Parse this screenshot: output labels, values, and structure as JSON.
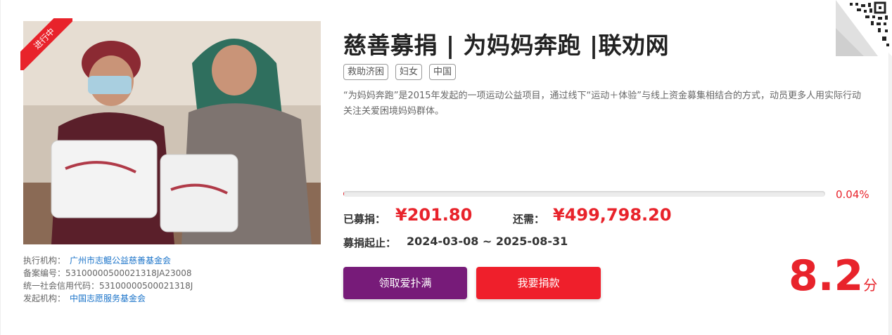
{
  "status_ribbon": "进行中",
  "title": "慈善募捐 | 为妈妈奔跑 |联劝网",
  "tags": [
    "救助济困",
    "妇女",
    "中国"
  ],
  "description": "“为妈妈奔跑”是2015年发起的一项运动公益项目，通过线下“运动＋体验”与线上资金募集相结合的方式，动员更多人用实际行动关注关爱困境妈妈群体。",
  "progress": {
    "percent_text": "0.04%",
    "fraction": 0.0004
  },
  "raised": {
    "label": "已募捐：",
    "value": "¥201.80"
  },
  "needed": {
    "label": "还需：",
    "value": "¥499,798.20"
  },
  "period": {
    "label": "募捐起止：",
    "value": "2024-03-08 ~ 2025-08-31"
  },
  "buttons": {
    "claim": "领取爱扑满",
    "donate": "我要捐款"
  },
  "score": {
    "value": "8.2",
    "unit": "分"
  },
  "org": {
    "exec_label": "执行机构：",
    "exec_value": "广州市志鲲公益慈善基金会",
    "record_label": "备案编号：",
    "record_value": "53100000500021318JA23008",
    "credit_label": "统一社会信用代码：",
    "credit_value": "53100000500021318J",
    "initiator_label": "发起机构：",
    "initiator_value": "中国志愿服务基金会"
  },
  "colors": {
    "accent": "#e8232b",
    "purple": "#771b79"
  },
  "icons": {
    "corner": "qr-code-icon"
  }
}
